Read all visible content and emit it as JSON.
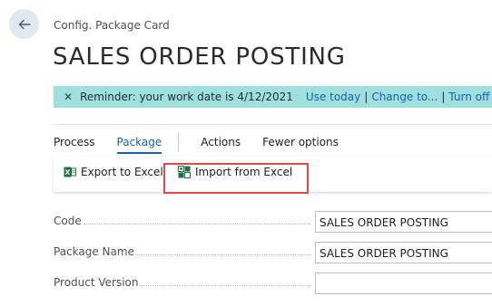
{
  "header": {
    "breadcrumb": "Config. Package Card",
    "title": "SALES ORDER POSTING"
  },
  "reminder": {
    "message": "Reminder: your work date is 4/12/2021",
    "use_today": "Use today",
    "change_to": "Change to...",
    "turn_off": "Turn off rem",
    "separator": "|"
  },
  "actions_bar": {
    "tabs": [
      "Process",
      "Package",
      "Actions",
      "Fewer options"
    ],
    "active_tab": "Package"
  },
  "toolbar": {
    "export_label": "Export to Excel",
    "import_label": "Import from Excel"
  },
  "fields": [
    {
      "label": "Code",
      "value": "SALES ORDER POSTING"
    },
    {
      "label": "Package Name",
      "value": "SALES ORDER POSTING"
    },
    {
      "label": "Product Version",
      "value": ""
    }
  ],
  "colors": {
    "accent": "#1563a9",
    "reminder_bg": "#9fe0df",
    "highlight": "#e04a4a",
    "excel_green": "#1e7145"
  },
  "icons": {
    "back": "arrow-left-icon",
    "close": "close-icon",
    "export": "excel-export-icon",
    "import": "excel-import-icon"
  }
}
